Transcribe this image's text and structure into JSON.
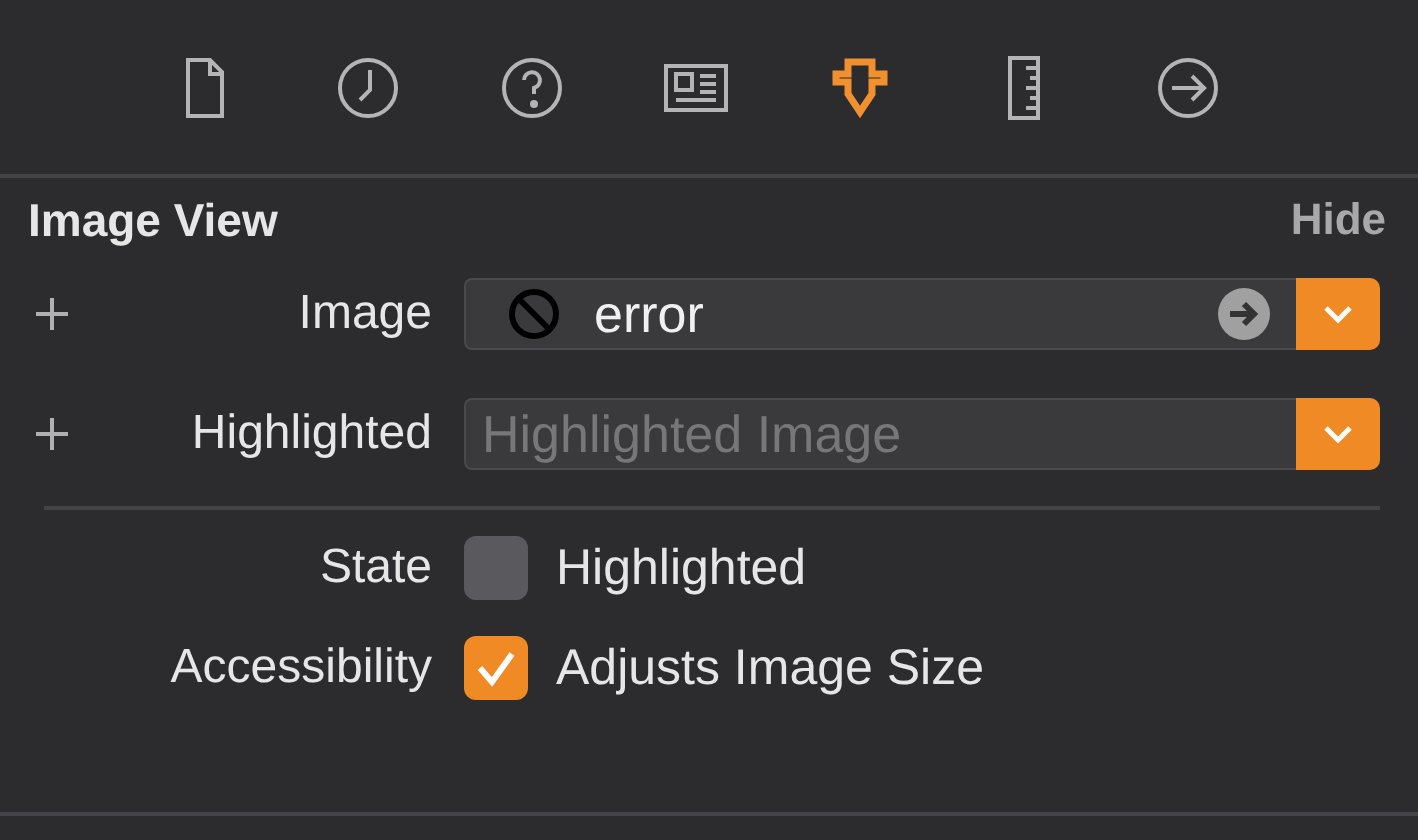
{
  "toolbar": {
    "tabs": [
      {
        "kind": "file",
        "selected": false
      },
      {
        "kind": "history",
        "selected": false
      },
      {
        "kind": "help",
        "selected": false
      },
      {
        "kind": "identity",
        "selected": false
      },
      {
        "kind": "attributes",
        "selected": true
      },
      {
        "kind": "size",
        "selected": false
      },
      {
        "kind": "connections",
        "selected": false
      }
    ]
  },
  "section": {
    "title": "Image View",
    "action": "Hide"
  },
  "fields": [
    {
      "label": "Image",
      "value": "error",
      "kind": "image"
    },
    {
      "label": "Highlighted",
      "placeholder": "Highlighted Image",
      "kind": "placeholder"
    }
  ],
  "options": [
    {
      "label": "State",
      "text": "Highlighted",
      "checked": false
    },
    {
      "label": "Accessibility",
      "text": "Adjusts Image Size",
      "checked": true
    }
  ]
}
